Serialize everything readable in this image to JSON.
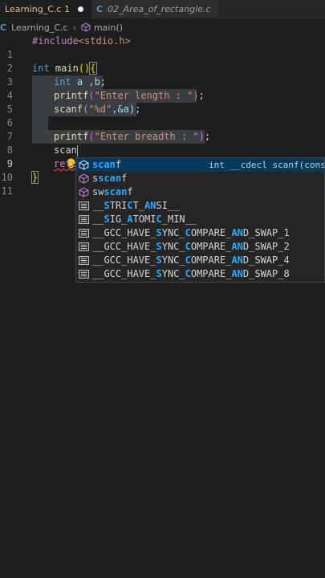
{
  "tabs": [
    {
      "label": "Learning_C.c 1",
      "active": true,
      "modified": true
    },
    {
      "label": "02_Area_of_rectangle.c",
      "active": false,
      "icon": "C"
    }
  ],
  "breadcrumb": {
    "file": "Learning_C.c",
    "symbol": "main()"
  },
  "lines": [
    "1",
    "2",
    "3",
    "4",
    "5",
    "6",
    "7",
    "8",
    "9",
    "10",
    "11"
  ],
  "code": {
    "l1_include": "#include",
    "l1_header": "<stdio.h>",
    "l3_type": "int",
    "l3_fn": " main",
    "l4_type": "int",
    "l4_vars": " a ,b;",
    "l5_fn": "printf",
    "l5_str": "\"Enter length : \"",
    "l6_fn": "scanf",
    "l6_str": "\"%d\"",
    "l6_rest": ",&a);",
    "l8_fn": "printf",
    "l8_str": "\"Enter breadth : \"",
    "l9_text": "scan",
    "l10_text": "retu"
  },
  "suggestions": [
    {
      "pre": "",
      "match": "scan",
      "post": "f",
      "kind": "function",
      "detail": "int __cdecl scanf(const c"
    },
    {
      "pre": "s",
      "match": "scan",
      "post": "f",
      "kind": "function",
      "detail": ""
    },
    {
      "pre": "sw",
      "match": "scan",
      "post": "f",
      "kind": "function",
      "detail": ""
    },
    {
      "parts": [
        "__",
        "S",
        "TRI",
        "C",
        "T_",
        "AN",
        "SI__"
      ],
      "kind": "macro"
    },
    {
      "parts": [
        "__",
        "S",
        "IG_",
        "A",
        "TOMI",
        "C",
        "_MIN__"
      ],
      "kind": "macro"
    },
    {
      "parts": [
        "__GCC_HAVE_",
        "S",
        "YNC_",
        "C",
        "OMPARE_",
        "AN",
        "D_SWAP_1"
      ],
      "kind": "macro"
    },
    {
      "parts": [
        "__GCC_HAVE_",
        "S",
        "YNC_",
        "C",
        "OMPARE_",
        "AN",
        "D_SWAP_2"
      ],
      "kind": "macro"
    },
    {
      "parts": [
        "__GCC_HAVE_",
        "S",
        "YNC_",
        "C",
        "OMPARE_",
        "AN",
        "D_SWAP_4"
      ],
      "kind": "macro"
    },
    {
      "parts": [
        "__GCC_HAVE_",
        "S",
        "YNC_",
        "C",
        "OMPARE_",
        "AN",
        "D_SWAP_8"
      ],
      "kind": "macro"
    }
  ]
}
